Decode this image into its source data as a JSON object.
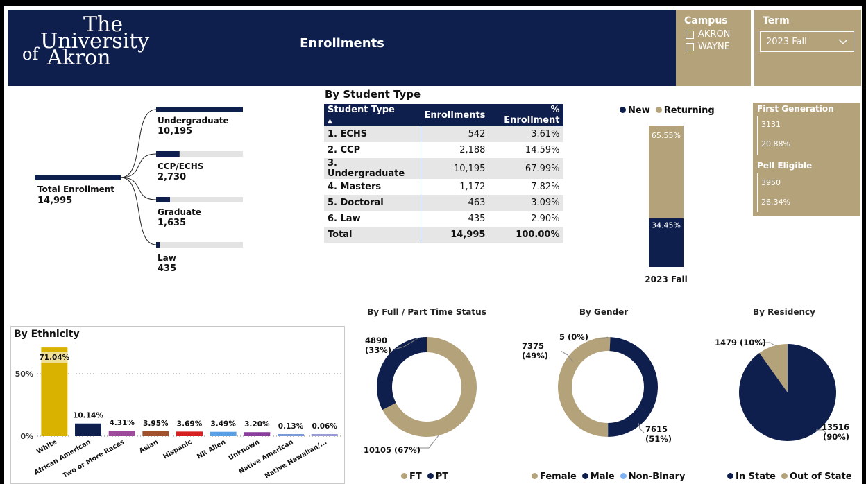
{
  "header": {
    "logo_lines": [
      "The",
      "University",
      "of",
      "Akron"
    ],
    "title": "Enrollments"
  },
  "campus": {
    "title": "Campus",
    "options": [
      "AKRON",
      "WAYNE"
    ]
  },
  "term": {
    "title": "Term",
    "selected": "2023 Fall"
  },
  "enrollment_tree": {
    "root_label": "Total Enrollment",
    "root_value": "14,995",
    "children": [
      {
        "label": "Undergraduate",
        "value": "10,195",
        "fraction": 1.0
      },
      {
        "label": "CCP/ECHS",
        "value": "2,730",
        "fraction": 0.27
      },
      {
        "label": "Graduate",
        "value": "1,635",
        "fraction": 0.16
      },
      {
        "label": "Law",
        "value": "435",
        "fraction": 0.04
      }
    ]
  },
  "student_type": {
    "title": "By Student Type",
    "columns": [
      "Student Type",
      "Enrollments",
      "% Enrollment"
    ],
    "rows": [
      [
        "1. ECHS",
        "542",
        "3.61%"
      ],
      [
        "2. CCP",
        "2,188",
        "14.59%"
      ],
      [
        "3. Undergraduate",
        "10,195",
        "67.99%"
      ],
      [
        "4. Masters",
        "1,172",
        "7.82%"
      ],
      [
        "5. Doctoral",
        "463",
        "3.09%"
      ],
      [
        "6. Law",
        "435",
        "2.90%"
      ]
    ],
    "total": [
      "Total",
      "14,995",
      "100.00%"
    ],
    "sort_indicator": "▲"
  },
  "new_returning": {
    "legend": [
      "New",
      "Returning"
    ],
    "colors": {
      "New": "#0f1f4d",
      "Returning": "#b4a27b"
    },
    "category": "2023 Fall",
    "new_pct": 34.45,
    "returning_pct": 65.55,
    "new_label": "34.45%",
    "returning_label": "65.55%"
  },
  "kpis": {
    "first_generation": {
      "title": "First Generation",
      "count": "3131",
      "pct": "20.88%"
    },
    "pell_eligible": {
      "title": "Pell Eligible",
      "count": "3950",
      "pct": "26.34%"
    }
  },
  "chart_data": [
    {
      "type": "bar",
      "title": "By Ethnicity",
      "categories": [
        "White",
        "African American",
        "Two or More Races",
        "Asian",
        "Hispanic",
        "NR Alien",
        "Unknown",
        "Native American",
        "Native Hawaiian/..."
      ],
      "values": [
        71.04,
        10.14,
        4.31,
        3.95,
        3.69,
        3.49,
        3.2,
        0.13,
        0.06
      ],
      "value_labels": [
        "71.04%",
        "10.14%",
        "4.31%",
        "3.95%",
        "3.69%",
        "3.49%",
        "3.20%",
        "0.13%",
        "0.06%"
      ],
      "colors": [
        "#d9b200",
        "#0f1f4d",
        "#a04a9c",
        "#a0522d",
        "#d92020",
        "#5aa0e6",
        "#8a3c9c",
        "#7a9bd6",
        "#9a9ad6"
      ],
      "yticks": [
        "0%",
        "50%"
      ],
      "ylim": [
        0,
        80
      ]
    },
    {
      "type": "pie",
      "title": "By Full / Part Time Status",
      "donut": true,
      "labels": [
        "FT",
        "PT"
      ],
      "values": [
        10105,
        4890
      ],
      "slice_labels": [
        "10105 (67%)",
        "4890 (33%)"
      ],
      "colors": [
        "#b4a27b",
        "#0f1f4d"
      ]
    },
    {
      "type": "pie",
      "title": "By Gender",
      "donut": true,
      "labels": [
        "Female",
        "Male",
        "Non-Binary"
      ],
      "values": [
        7615,
        7375,
        5
      ],
      "slice_labels": [
        "7615 (51%)",
        "7375 (49%)",
        "5 (0%)"
      ],
      "colors": [
        "#b4a27b",
        "#0f1f4d",
        "#7fb2f0"
      ]
    },
    {
      "type": "pie",
      "title": "By Residency",
      "donut": false,
      "labels": [
        "In State",
        "Out of State"
      ],
      "values": [
        13516,
        1479
      ],
      "slice_labels": [
        "13516 (90%)",
        "1479 (10%)"
      ],
      "colors": [
        "#0f1f4d",
        "#b4a27b"
      ]
    }
  ]
}
